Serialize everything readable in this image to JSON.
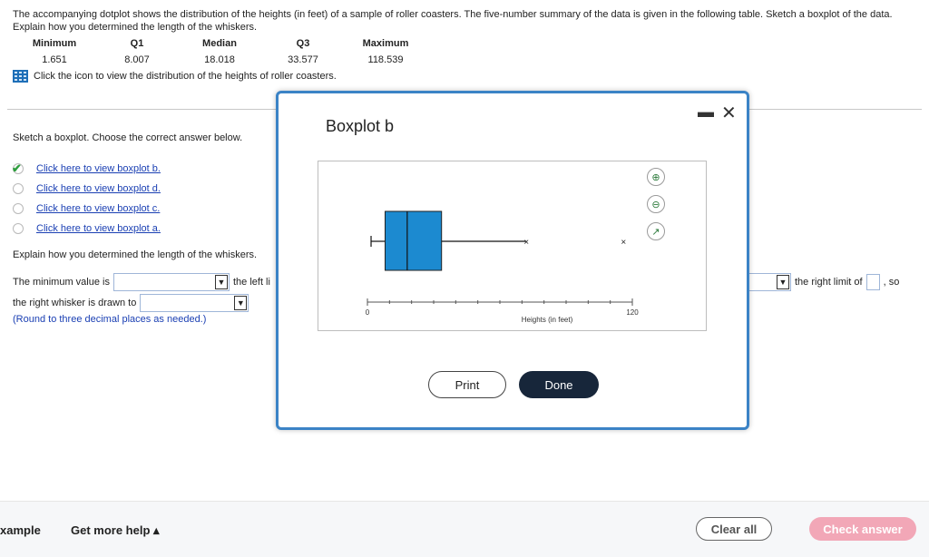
{
  "question": {
    "intro": "The accompanying dotplot shows the distribution of the heights (in feet) of a sample of roller coasters. The five-number summary of the data is given in the following table. Sketch a boxplot of the data. Explain how you determined the length of the whiskers.",
    "summary_headers": [
      "Minimum",
      "Q1",
      "Median",
      "Q3",
      "Maximum"
    ],
    "summary_values": [
      "1.651",
      "8.007",
      "18.018",
      "33.577",
      "118.539"
    ],
    "icon_text": "Click the icon to view the distribution of the heights of roller coasters.",
    "sketch_prompt": "Sketch a boxplot. Choose the correct answer below.",
    "options": [
      {
        "label": "Click here to view boxplot b.",
        "selected": true
      },
      {
        "label": "Click here to view boxplot d.",
        "selected": false
      },
      {
        "label": "Click here to view boxplot c.",
        "selected": false
      },
      {
        "label": "Click here to view boxplot a.",
        "selected": false
      }
    ],
    "explain_prompt": "Explain how you determined the length of the whiskers.",
    "min_prefix": "The minimum value is",
    "min_suffix": "the left li",
    "right_suffix": "the right limit of",
    "right_end": ", so",
    "whisker_text": "the right whisker is drawn to",
    "round_note": "(Round to three decimal places as needed.)"
  },
  "modal": {
    "title": "Boxplot b",
    "print_label": "Print",
    "done_label": "Done",
    "minimize_glyph": "▬",
    "close_glyph": "✕"
  },
  "chart_data": {
    "type": "boxplot",
    "title": "",
    "xlabel": "Heights (in feet)",
    "xlim": [
      0,
      120
    ],
    "tick_labels": [
      {
        "value": 0,
        "label": "0"
      },
      {
        "value": 120,
        "label": "120"
      }
    ],
    "whisker_low": 1.651,
    "q1": 8.007,
    "median": 18.018,
    "q3": 33.577,
    "whisker_high": 72,
    "outliers": [
      72,
      116
    ],
    "box_color": "#1c8ad0"
  },
  "footer": {
    "example_label": "xample",
    "help_label": "Get more help ▴",
    "clear_label": "Clear all",
    "check_label": "Check answer"
  },
  "colors": {
    "link": "#1a3fb3",
    "modal_border": "#3b83c6",
    "done_bg": "#17263a",
    "check_bg": "#f2a7b7"
  }
}
